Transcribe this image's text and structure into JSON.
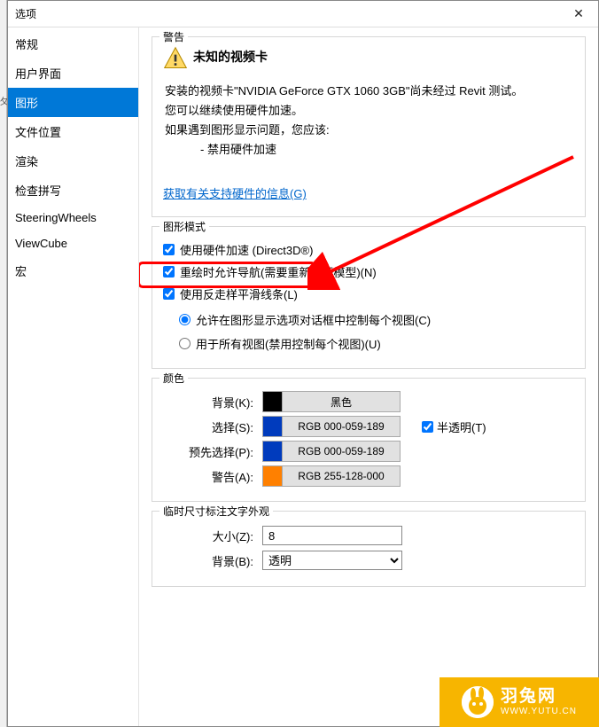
{
  "dialog": {
    "title": "选项"
  },
  "sidebar": {
    "items": [
      {
        "label": "常规"
      },
      {
        "label": "用户界面"
      },
      {
        "label": "图形"
      },
      {
        "label": "文件位置"
      },
      {
        "label": "渲染"
      },
      {
        "label": "检查拼写"
      },
      {
        "label": "SteeringWheels"
      },
      {
        "label": "ViewCube"
      },
      {
        "label": "宏"
      }
    ],
    "selected_index": 2
  },
  "warning": {
    "group_title": "警告",
    "title": "未知的视频卡",
    "line1": "安装的视频卡\"NVIDIA GeForce GTX 1060 3GB\"尚未经过 Revit 测试。",
    "line2": "您可以继续使用硬件加速。",
    "line3": "如果遇到图形显示问题，您应该:",
    "line4": "- 禁用硬件加速",
    "link": "获取有关支持硬件的信息(G)"
  },
  "graphics_mode": {
    "group_title": "图形模式",
    "hw_accel_label": "使用硬件加速 (Direct3D®)",
    "hw_accel_checked": true,
    "redraw_label": "重绘时允许导航(需要重新打开模型)(N)",
    "redraw_checked": true,
    "antialias_label": "使用反走样平滑线条(L)",
    "antialias_checked": true,
    "radio1_label": "允许在图形显示选项对话框中控制每个视图(C)",
    "radio2_label": "用于所有视图(禁用控制每个视图)(U)"
  },
  "colors": {
    "group_title": "颜色",
    "bg_label": "背景(K):",
    "bg_name": "黑色",
    "bg_hex": "#000000",
    "sel_label": "选择(S):",
    "sel_name": "RGB 000-059-189",
    "sel_hex": "#003bbd",
    "presel_label": "预先选择(P):",
    "presel_name": "RGB 000-059-189",
    "presel_hex": "#003bbd",
    "warn_label": "警告(A):",
    "warn_name": "RGB 255-128-000",
    "warn_hex": "#ff8000",
    "semi_label": "半透明(T)",
    "semi_checked": true
  },
  "dim": {
    "group_title": "临时尺寸标注文字外观",
    "size_label": "大小(Z):",
    "size_value": "8",
    "bg_label": "背景(B):",
    "bg_value": "透明"
  },
  "logo": {
    "cn": "羽兔网",
    "en": "WWW.YUTU.CN"
  }
}
